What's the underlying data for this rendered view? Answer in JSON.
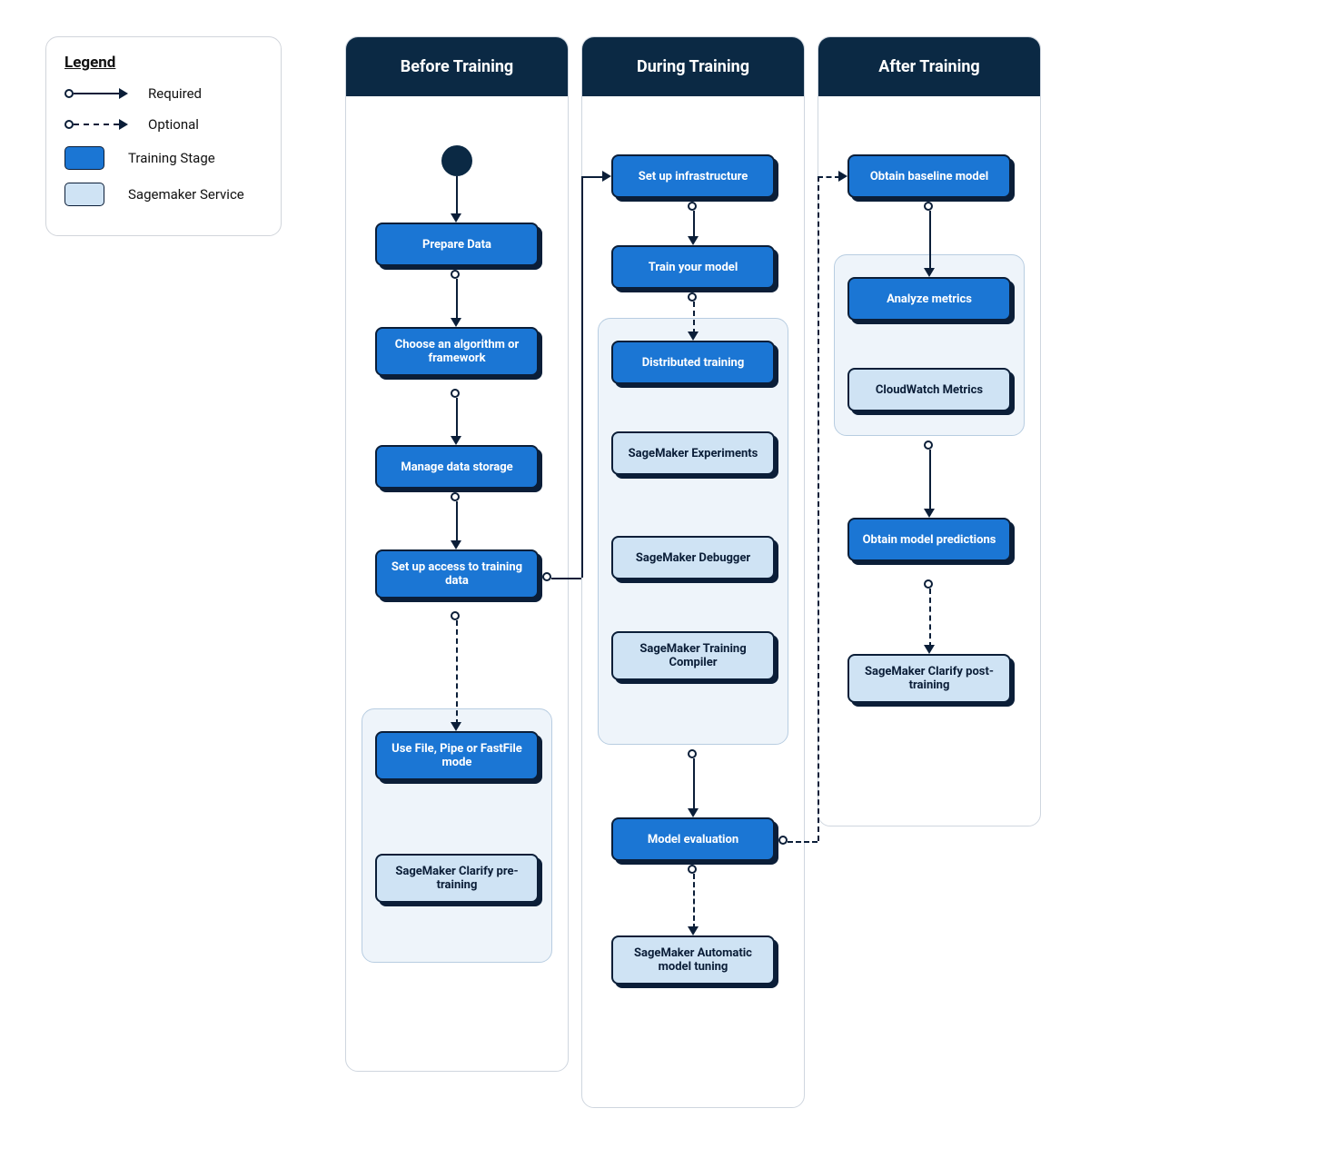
{
  "legend": {
    "title": "Legend",
    "required": "Required",
    "optional": "Optional",
    "stage": "Training Stage",
    "service": "Sagemaker Service"
  },
  "columns": {
    "before": "Before Training",
    "during": "During Training",
    "after": "After Training"
  },
  "nodes": {
    "prepare_data": "Prepare Data",
    "choose_algo": "Choose an algorithm or framework",
    "manage_storage": "Manage data storage",
    "setup_access": "Set up access to training data",
    "file_mode": "Use File, Pipe or FastFile mode",
    "clarify_pre": "SageMaker Clarify pre-training",
    "setup_infra": "Set up infrastructure",
    "train_model": "Train your model",
    "distributed": "Distributed training",
    "experiments": "SageMaker Experiments",
    "debugger": "SageMaker Debugger",
    "training_compiler": "SageMaker Training Compiler",
    "model_eval": "Model evaluation",
    "auto_tuning": "SageMaker Automatic model tuning",
    "obtain_baseline": "Obtain baseline model",
    "analyze_metrics": "Analyze metrics",
    "cloudwatch": "CloudWatch Metrics",
    "obtain_predictions": "Obtain model predictions",
    "clarify_post": "SageMaker Clarify post-training"
  }
}
